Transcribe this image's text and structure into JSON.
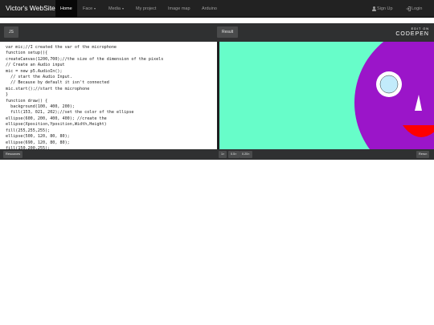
{
  "navbar": {
    "brand": "Victor's WebSite",
    "items": [
      {
        "label": "Home"
      },
      {
        "label": "Face"
      },
      {
        "label": "Media"
      },
      {
        "label": "My project"
      },
      {
        "label": "Image map"
      },
      {
        "label": "Arduino"
      }
    ],
    "sign_up": "Sign Up",
    "login": "Login"
  },
  "embed": {
    "tab_js": "JS",
    "tab_result": "Result",
    "logo_top": "EDIT ON",
    "logo_bottom": "CODEPEN",
    "code": "var mic;//I created the var of the microphone\nfunction setup(){\ncreateCanvas(1200,700);//the size of the dimension of the pixels\n// Create an Audio input\nmic = new p5.AudioIn();\n  // start the Audio Input.\n  // Because by default it isn't connected\nmic.start();//start the microphone\n}\nfunction draw() {\n  background(100, 400, 200);\n  fill(153, 021, 202);//set the color of the ellipse\nellipse(600, 200, 400, 400); //create the\nellipse(Xposition,Yposition,Width,Height)\nfill(255,255,255);\nellipse(500, 120, 80, 80);\nellipse(690, 120, 80, 80);\nfill(150,200,255);",
    "footer": {
      "resources": "Resources",
      "zoom_1x": "1×",
      "zoom_05x": "0.5×",
      "zoom_025x": "0.25×",
      "rerun": "Rerun"
    }
  },
  "colors": {
    "result_bg": "#67fdc9",
    "face": "#9b15c9",
    "mouth": "#ff0000"
  }
}
